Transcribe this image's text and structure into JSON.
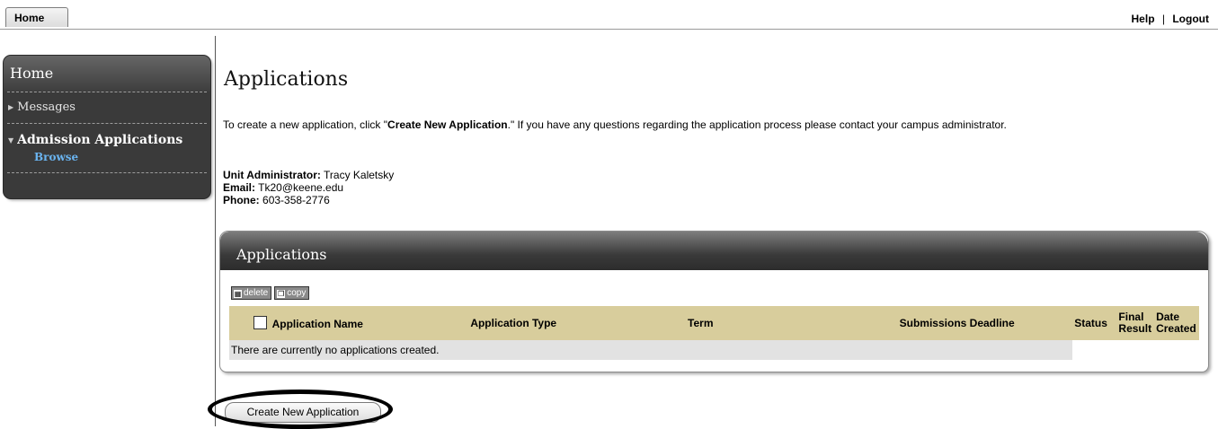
{
  "topbar": {
    "home_tab": "Home",
    "help": "Help",
    "separator": "|",
    "logout": "Logout"
  },
  "sidebar": {
    "header": "Home",
    "items": [
      {
        "label": "Messages"
      },
      {
        "label": "Admission Applications",
        "sub": [
          "Browse"
        ]
      }
    ]
  },
  "main": {
    "title": "Applications",
    "intro_before": "To create a new application, click \"",
    "intro_bold": "Create New Application",
    "intro_after": ".\" If you have any questions regarding the application process please contact your campus administrator.",
    "contact": {
      "admin_label": "Unit Administrator:",
      "admin_value": "Tracy Kaletsky",
      "email_label": "Email:",
      "email_value": "Tk20@keene.edu",
      "phone_label": "Phone:",
      "phone_value": "603-358-2776"
    }
  },
  "panel": {
    "header": "Applications",
    "toolbar": {
      "delete": "delete",
      "copy": "copy"
    },
    "columns": [
      "Application Name",
      "Application Type",
      "Term",
      "Submissions Deadline",
      "Status",
      "Final Result",
      "Date Created"
    ],
    "empty_message": "There are currently no applications created."
  },
  "create_button": "Create New Application"
}
